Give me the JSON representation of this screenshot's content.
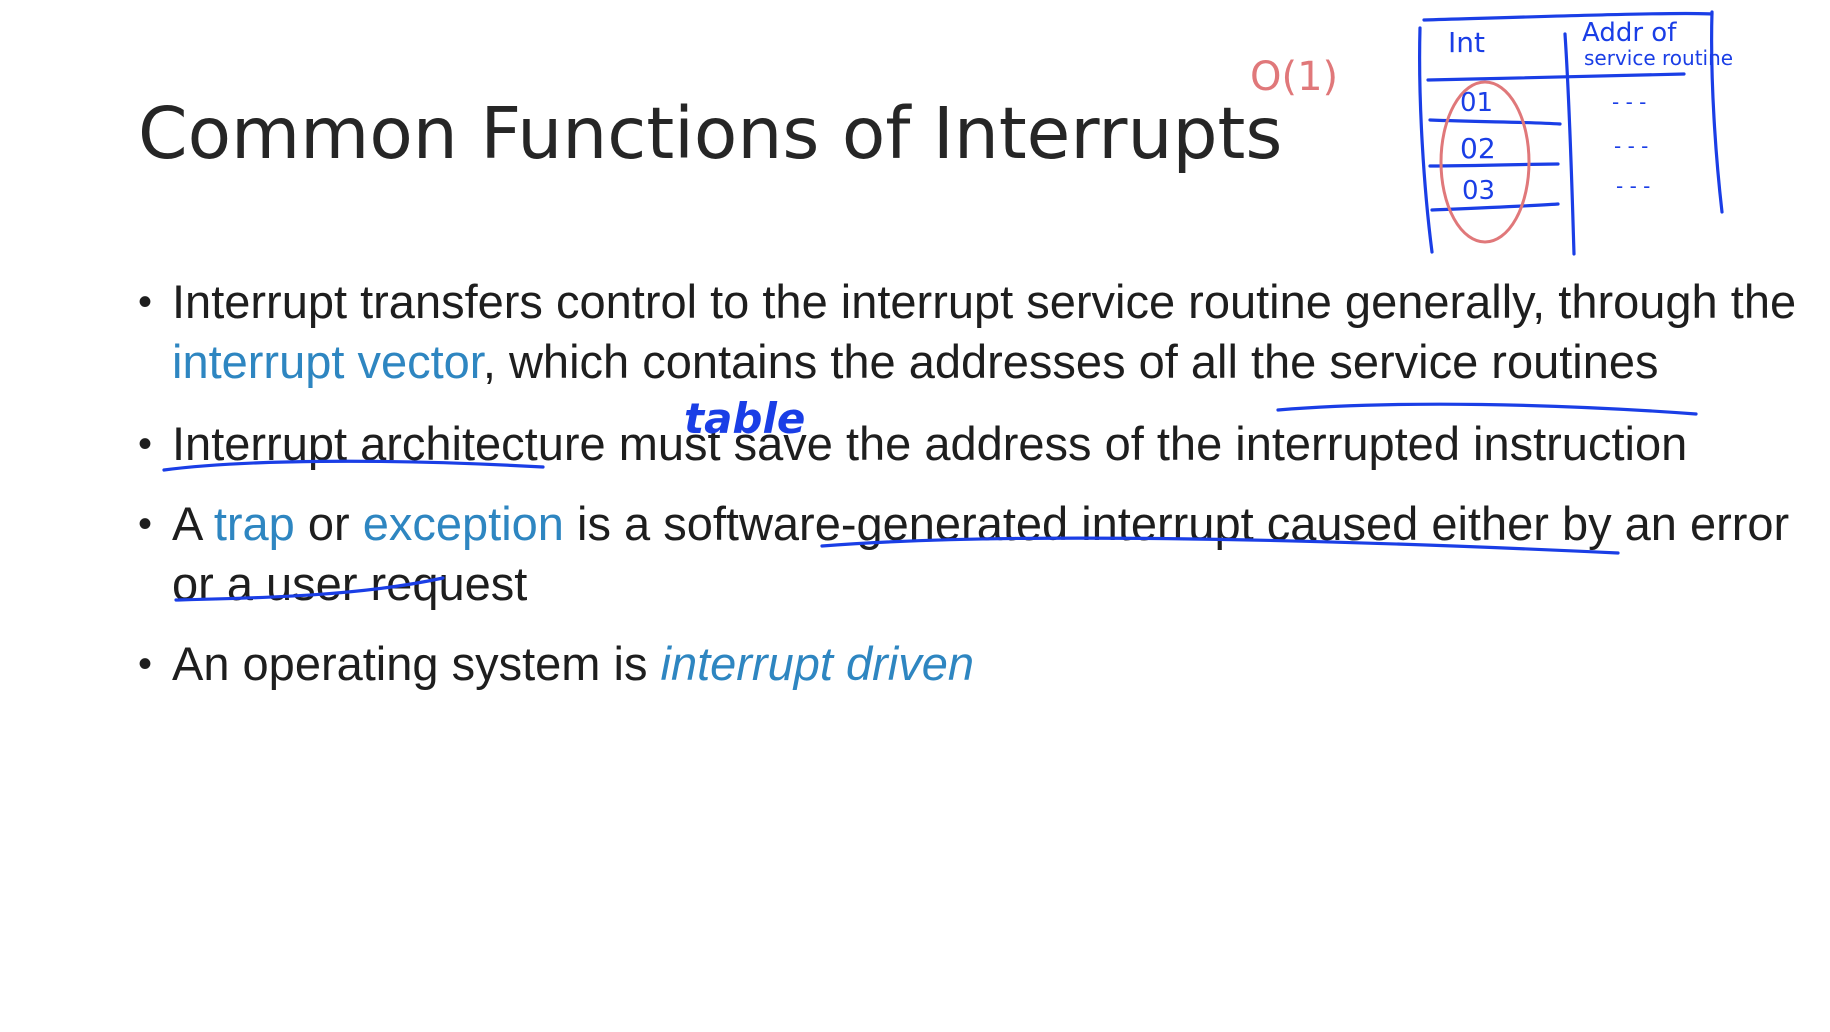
{
  "slide": {
    "title": "Common Functions of Interrupts",
    "bullets": [
      {
        "parts": [
          "Interrupt transfers control to the interrupt service routine generally, through the ",
          "interrupt vector",
          ", which contains the addresses of all the service routines"
        ]
      },
      {
        "parts": [
          "Interrupt architecture must save the address of the interrupted instruction"
        ]
      },
      {
        "parts": [
          "A ",
          "trap",
          " or ",
          "exception",
          " is a software-generated interrupt caused either by an error or a user request"
        ]
      },
      {
        "parts": [
          "An operating system is ",
          "interrupt driven"
        ]
      }
    ],
    "bullet_symbol": "•"
  },
  "annotations": {
    "table_note": "table",
    "complexity_note": "O(1)",
    "table_header_int": "Int",
    "table_header_addr_line1": "Addr of",
    "table_header_addr_line2": "service routine",
    "table_rows": [
      "01",
      "02",
      "03"
    ],
    "table_values": [
      "- - -",
      "- - -",
      "- - -"
    ]
  },
  "colors": {
    "text": "#1e1e1e",
    "accent": "#2e86c1",
    "ink_blue": "#1a3ee6",
    "ink_red": "#e0787a"
  }
}
